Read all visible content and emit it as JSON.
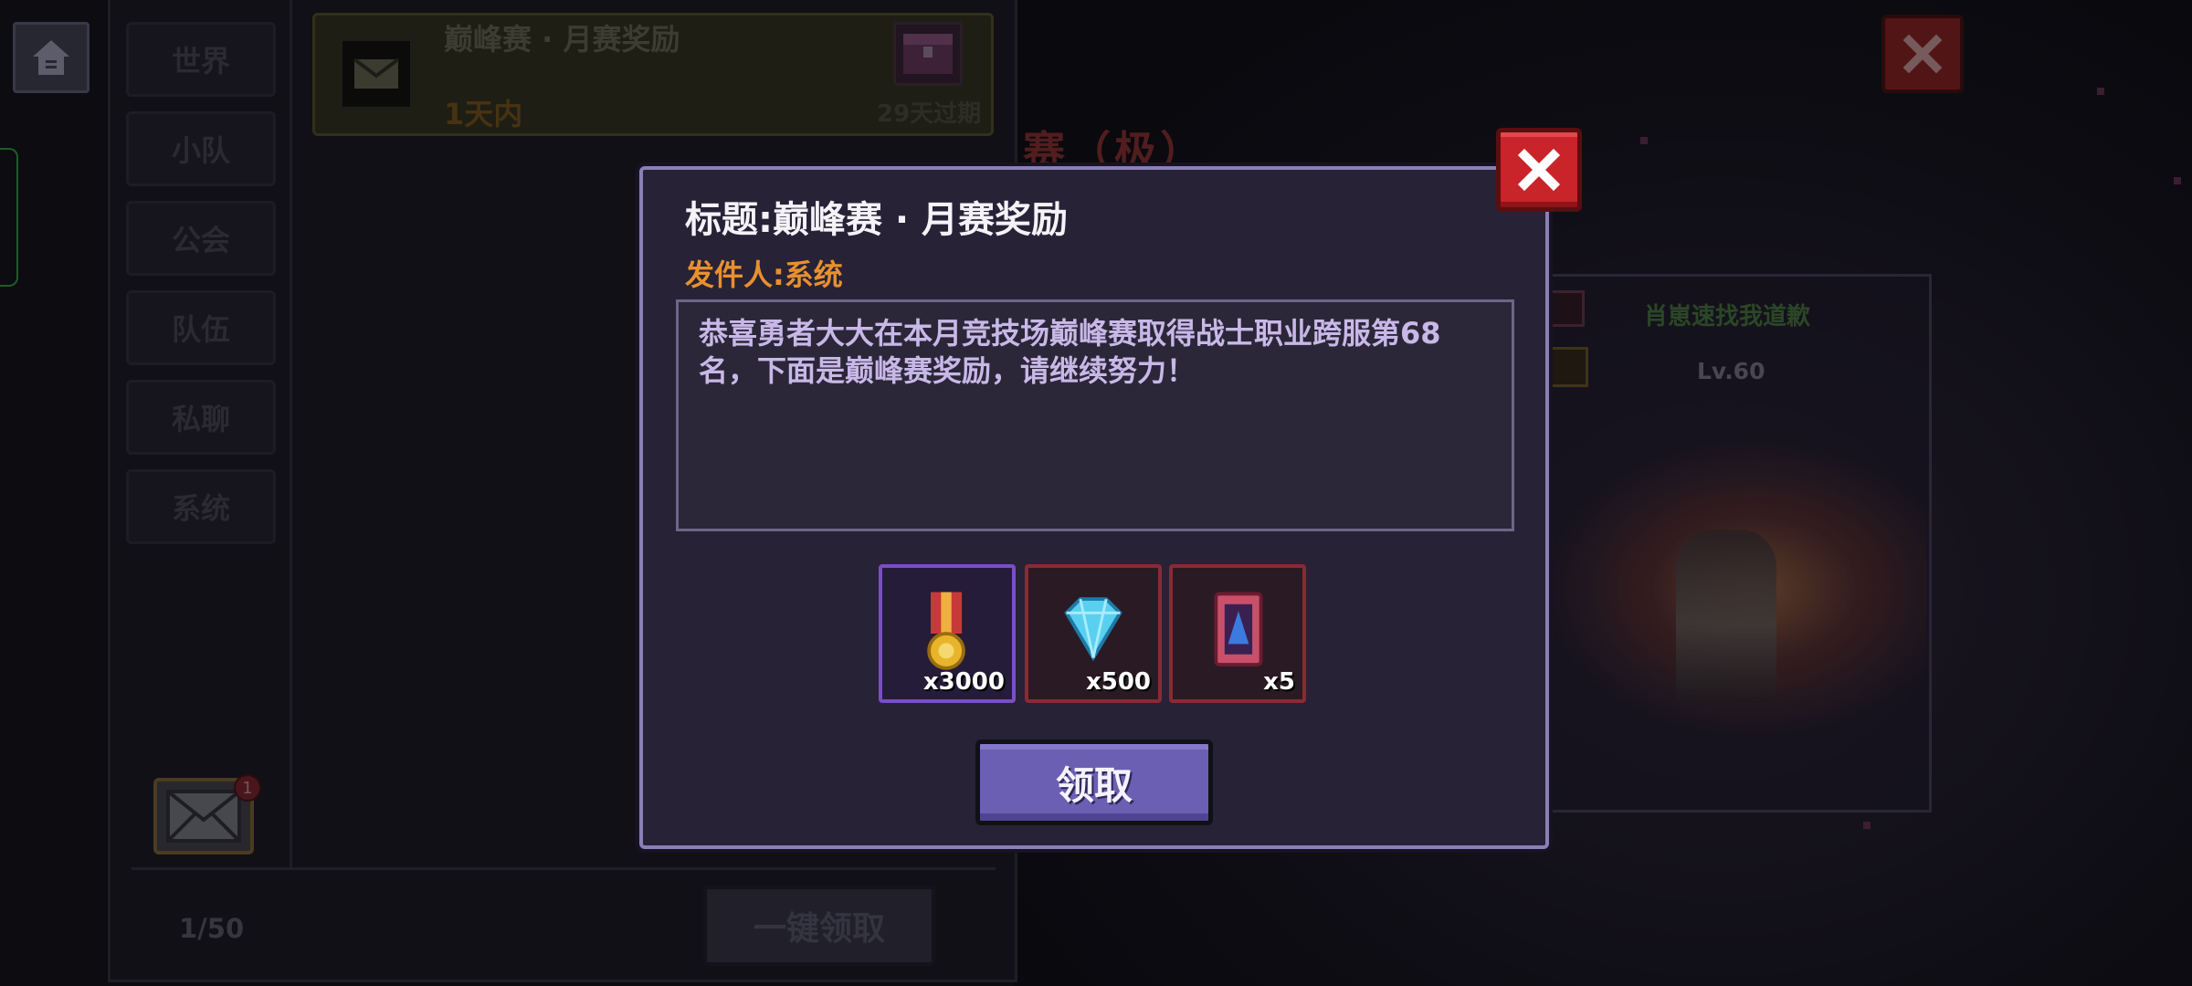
{
  "background": {
    "title_fragment": "赛（极）",
    "player_name": "肖崽速找我道歉",
    "player_level": "Lv.60"
  },
  "sidebar": {
    "home_icon": "home-icon",
    "categories": [
      "世界",
      "小队",
      "公会",
      "队伍",
      "私聊",
      "系统"
    ]
  },
  "mail_list": {
    "item": {
      "title": "巅峰赛 · 月赛奖励",
      "received": "1天内",
      "expires": "29天过期"
    },
    "count": "1/50",
    "claim_all_label": "一键领取",
    "unread_badge": "1"
  },
  "dialog": {
    "title": "标题:巅峰赛 · 月赛奖励",
    "sender": "发件人:系统",
    "body": "恭喜勇者大大在本月竞技场巅峰赛取得战士职业跨服第68名，下面是巅峰赛奖励，请继续努力！",
    "rewards": [
      {
        "icon": "medal-icon",
        "qty": "x3000"
      },
      {
        "icon": "diamond-icon",
        "qty": "x500"
      },
      {
        "icon": "card-icon",
        "qty": "x5"
      }
    ],
    "claim_label": "领取"
  },
  "colors": {
    "dialog_border": "#8b7fb8",
    "sender": "#e89030",
    "claim_button": "#6b5fb4",
    "close_button": "#c8242a"
  }
}
